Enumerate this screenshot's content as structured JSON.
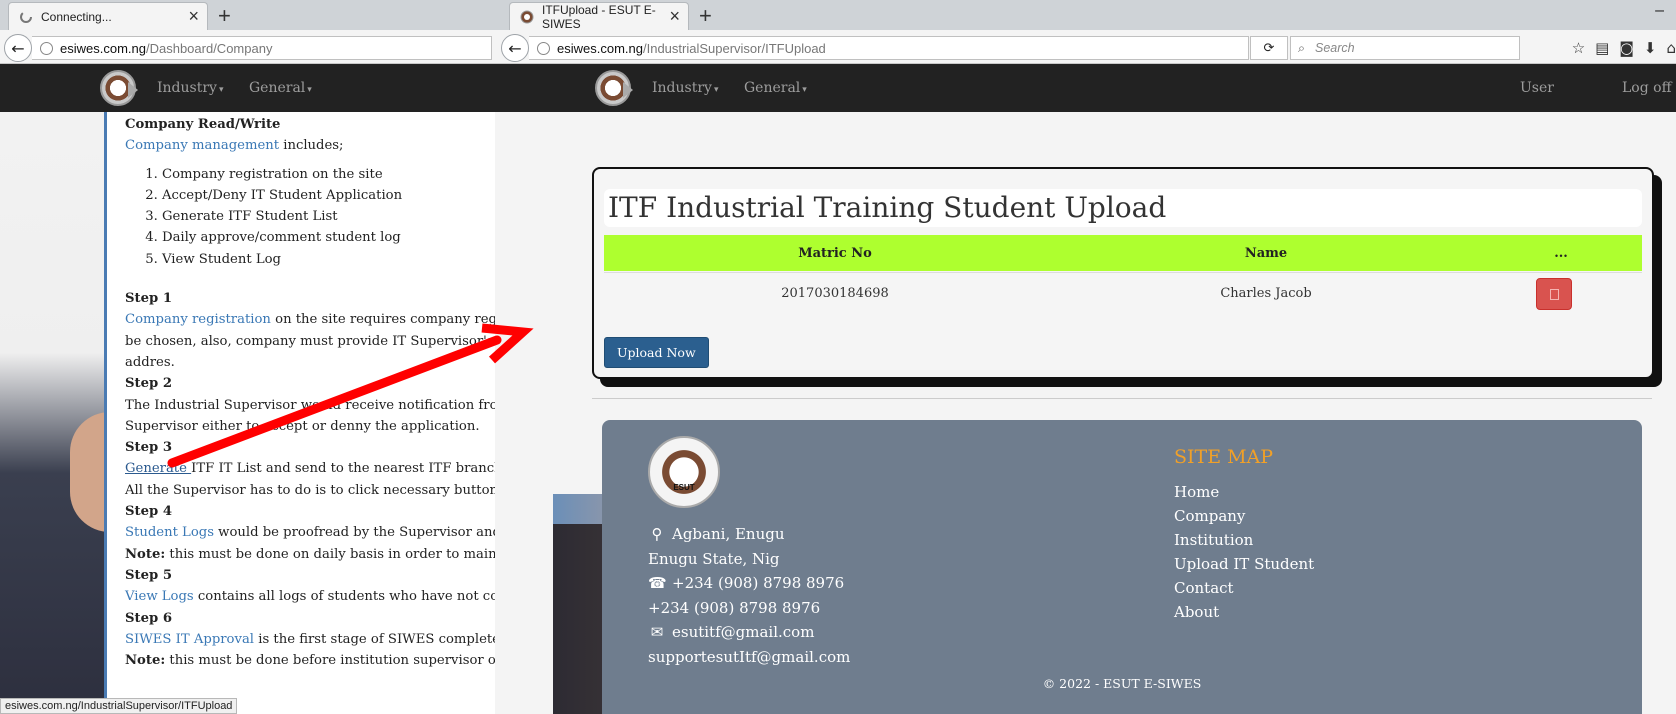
{
  "left_window": {
    "tab_title": "Connecting...",
    "url_host": "esiwes.com.ng",
    "url_path": "/Dashboard/Company",
    "nav": {
      "industry": "Industry",
      "general": "General"
    },
    "status_bar": "esiwes.com.ng/IndustrialSupervisor/ITFUpload",
    "article": {
      "heading": "Company Read/Write",
      "intro_link": "Company management",
      "intro_rest": " includes;",
      "list": [
        "Company registration on the site",
        "Accept/Deny IT Student Application",
        "Generate ITF Student List",
        "Daily approve/comment student log",
        "View Student Log"
      ],
      "step1_title": "Step 1",
      "step1_link": "Company registration",
      "step1_l1": " on the site requires company regis",
      "step1_l2": "be chosen, also, company must provide IT Supervisor's e",
      "step1_l3": "addres.",
      "step2_title": "Step 2",
      "step2_l1": "The Industrial Supervisor would receive notification from a",
      "step2_l2": "Supervisor either to accept or denny the application.",
      "step3_title": "Step 3",
      "step3_link": "Generate ",
      "step3_l1": "ITF IT List and send to the nearest ITF branch as ",
      "step3_l2": "All the Supervisor has to do is to click necessary buttons ar",
      "step4_title": "Step 4",
      "step4_link": "Student Logs",
      "step4_l1": " would be proofread by the Supervisor and en",
      "step4_note": "Note:",
      "step4_l2": " this must be done on daily basis in order to maintain",
      "step5_title": "Step 5",
      "step5_link": "View Logs",
      "step5_l1": " contains all logs of students who have not comp",
      "step6_title": "Step 6",
      "step6_link": "SIWES IT Approval",
      "step6_l1": " is the first stage of SIWES complete pro",
      "step6_note": "Note:",
      "step6_l2": " this must be done before institution supervisor or br"
    }
  },
  "right_window": {
    "tab_title": "ITFUpload - ESUT E-SIWES",
    "url_host": "esiwes.com.ng",
    "url_path": "/IndustrialSupervisor/ITFUpload",
    "search_placeholder": "Search",
    "nav": {
      "industry": "Industry",
      "general": "General",
      "user": "User",
      "logoff": "Log off"
    },
    "card": {
      "title": "ITF Industrial Training Student Upload",
      "headers": [
        "Matric No",
        "Name",
        "..."
      ],
      "rows": [
        {
          "matric": "2017030184698",
          "name": "Charles Jacob"
        }
      ],
      "upload_button": "Upload Now"
    },
    "footer": {
      "logo_text": "ESUT",
      "address_line1": "Agbani, Enugu",
      "address_line2": "Enugu State, Nig",
      "phone1": "+234 (908) 8798 8976",
      "phone2": "+234 (908) 8798 8976",
      "email1": "esutitf@gmail.com",
      "email2": "supportesutItf@gmail.com",
      "sitemap_title": "SITE MAP",
      "sitemap_links": [
        "Home",
        "Company",
        "Institution",
        "Upload IT Student",
        "Contact",
        "About"
      ],
      "copyright": "© 2022 - ESUT E-SIWES"
    }
  },
  "colors": {
    "navbar": "#222222",
    "table_header": "#aeff2f",
    "delete_button": "#d9534f",
    "upload_button": "#2b5f8f",
    "footer": "#6f7d8e",
    "sitemap_title": "#f0a028",
    "link": "#3a78b5",
    "annotation_arrow": "#ff0000"
  }
}
